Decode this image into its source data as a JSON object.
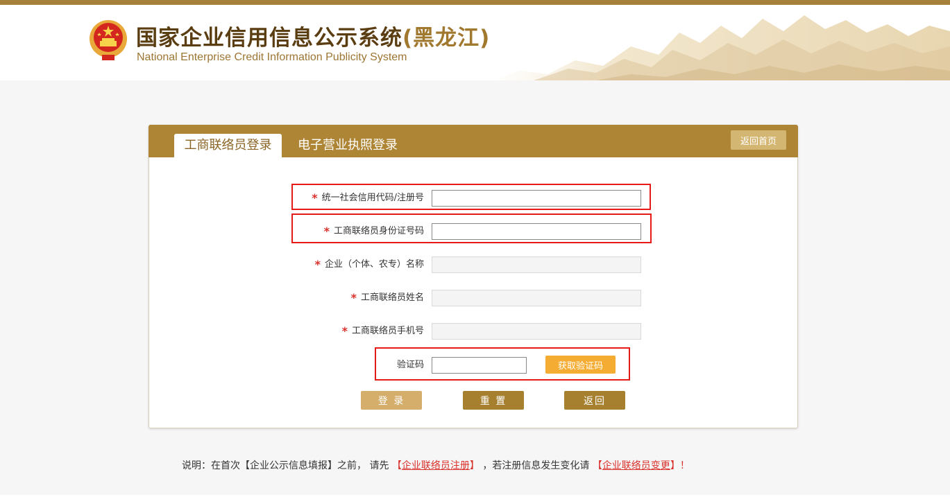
{
  "header": {
    "title_main": "国家企业信用信息公示系统",
    "title_province": "(黑龙江)",
    "subtitle": "National Enterprise Credit Information Publicity System"
  },
  "tabs": {
    "active": "工商联络员登录",
    "inactive": "电子营业执照登录"
  },
  "home_button": "返回首页",
  "form": {
    "required_mark": "*",
    "fields": [
      {
        "label": "统一社会信用代码/注册号",
        "value": "",
        "required": true,
        "disabled": false
      },
      {
        "label": "工商联络员身份证号码",
        "value": "",
        "required": true,
        "disabled": false
      },
      {
        "label": "企业（个体、农专）名称",
        "value": "",
        "required": true,
        "disabled": true
      },
      {
        "label": "工商联络员姓名",
        "value": "",
        "required": true,
        "disabled": true
      },
      {
        "label": "工商联络员手机号",
        "value": "",
        "required": true,
        "disabled": true
      }
    ],
    "captcha_label": "验证码",
    "captcha_value": "",
    "get_code_button": "获取验证码",
    "buttons": {
      "login": "登 录",
      "reset": "重 置",
      "back": "返回"
    }
  },
  "note": {
    "prefix": "说明：在首次【企业公示信息填报】之前，  请先",
    "link1_open": "【",
    "link1": "企业联络员注册",
    "link1_close": "】",
    "middle": "，若注册信息发生变化请",
    "link2_open": "【",
    "link2": "企业联络员变更",
    "link2_close": "】",
    "suffix": "！"
  },
  "colors": {
    "brand": "#ae8535",
    "required": "#d9312b",
    "highlight": "#e51b1b",
    "sms_button": "#f5ac32"
  }
}
